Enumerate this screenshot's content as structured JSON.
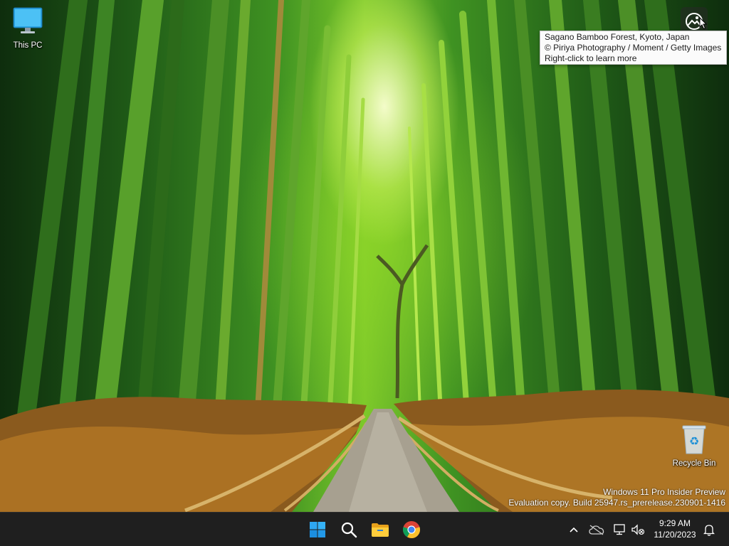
{
  "desktop": {
    "icons": [
      {
        "label": "This PC",
        "icon": "monitor-icon"
      },
      {
        "label": "Recycle Bin",
        "icon": "recycle-bin-icon"
      }
    ]
  },
  "spotlight": {
    "icon": "learn-about-picture-icon",
    "tooltip": {
      "line1": "Sagano Bamboo Forest, Kyoto, Japan",
      "line2": "© Piriya Photography / Moment / Getty Images",
      "line3": "Right-click to learn more"
    }
  },
  "watermark": {
    "line1": "Windows 11 Pro Insider Preview",
    "line2": "Evaluation copy. Build 25947.rs_prerelease.230901-1416"
  },
  "taskbar": {
    "apps": [
      {
        "name": "Start",
        "icon": "windows-start-icon"
      },
      {
        "name": "Search",
        "icon": "search-icon"
      },
      {
        "name": "File Explorer",
        "icon": "folder-icon"
      },
      {
        "name": "Google Chrome",
        "icon": "chrome-icon"
      }
    ],
    "tray": {
      "icons": [
        "chevron-up-icon",
        "onedrive-icon",
        "network-icon",
        "sound-muted-icon",
        "bell-icon"
      ],
      "time": "9:29 AM",
      "date": "11/20/2023"
    }
  },
  "colors": {
    "taskbar": "#1f1f1f",
    "accent": "#0078d4",
    "tooltip_bg": "#fbfbfb"
  }
}
